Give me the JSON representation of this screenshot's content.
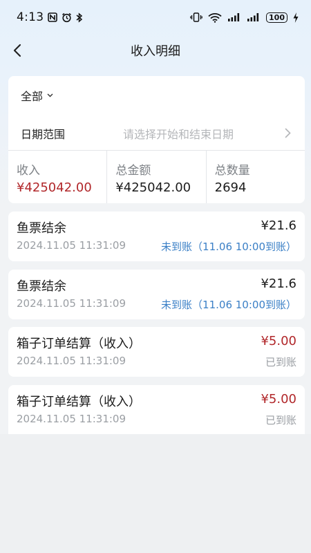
{
  "status_bar": {
    "time": "4:13",
    "battery": "100",
    "icons": [
      "nfc-icon",
      "alarm-icon",
      "bluetooth-icon",
      "vibrate-icon",
      "wifi-icon",
      "signal-icon",
      "signal-icon",
      "battery-icon",
      "charging-icon"
    ]
  },
  "header": {
    "title": "收入明细",
    "back_icon": "chevron-left-icon"
  },
  "filter": {
    "type_label": "全部",
    "date_label": "日期范围",
    "date_placeholder": "请选择开始和结束日期"
  },
  "stats": [
    {
      "label": "收入",
      "value": "¥425042.00",
      "color": "#b1272a"
    },
    {
      "label": "总金额",
      "value": "¥425042.00",
      "color": "#1c1c1c"
    },
    {
      "label": "总数量",
      "value": "2694",
      "color": "#1c1c1c"
    }
  ],
  "records": [
    {
      "title": "鱼票结余",
      "amount": "¥21.6",
      "time": "2024.11.05 11:31:09",
      "status": "未到账（11.06 10:00到账）",
      "amount_color": "#1c1c1c",
      "status_color": "#3a7fc6"
    },
    {
      "title": "鱼票结余",
      "amount": "¥21.6",
      "time": "2024.11.05 11:31:09",
      "status": "未到账（11.06 10:00到账）",
      "amount_color": "#1c1c1c",
      "status_color": "#3a7fc6"
    },
    {
      "title": "箱子订单结算（收入）",
      "amount": "¥5.00",
      "time": "2024.11.05 11:31:09",
      "status": "已到账",
      "amount_color": "#b1272a",
      "status_color": "#9a9ea3"
    },
    {
      "title": "箱子订单结算（收入）",
      "amount": "¥5.00",
      "time": "2024.11.05 11:31:09",
      "status": "已到账",
      "amount_color": "#b1272a",
      "status_color": "#9a9ea3"
    }
  ]
}
